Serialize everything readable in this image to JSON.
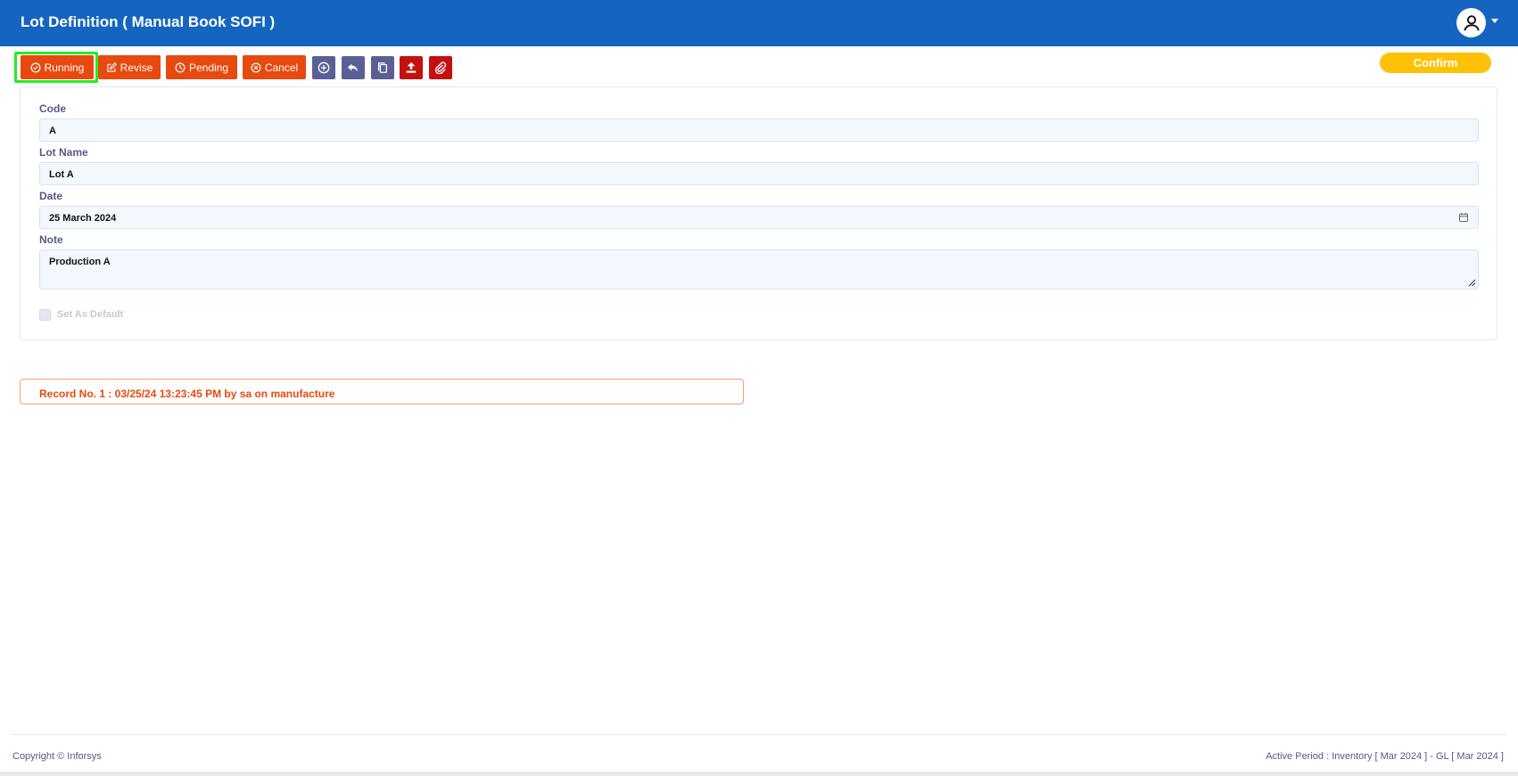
{
  "header": {
    "title": "Lot Definition ( Manual Book SOFI )",
    "background": "#1565c0"
  },
  "toolbar": {
    "running_label": "Running",
    "revise_label": "Revise",
    "pending_label": "Pending",
    "cancel_label": "Cancel",
    "icon_buttons": [
      "add-circle-icon",
      "undo-icon",
      "copy-icon",
      "upload-icon",
      "attach-icon"
    ],
    "confirm_label": "Confirm",
    "accent_orange": "#e8490f",
    "accent_yellow": "#ffc107"
  },
  "form": {
    "code": {
      "label": "Code",
      "value": "A"
    },
    "lot_name": {
      "label": "Lot Name",
      "value": "Lot A"
    },
    "date": {
      "label": "Date",
      "value": "25 March 2024"
    },
    "note": {
      "label": "Note",
      "value": "Production A"
    },
    "set_default": {
      "label": "Set As Default",
      "checked": false
    }
  },
  "record": {
    "text": "Record No. 1 : 03/25/24 13:23:45 PM by sa on manufacture"
  },
  "footer": {
    "copyright": "Copyright © Inforsys",
    "active_period": "Active Period  :  Inventory [ Mar 2024 ]  -  GL [ Mar 2024 ]"
  }
}
